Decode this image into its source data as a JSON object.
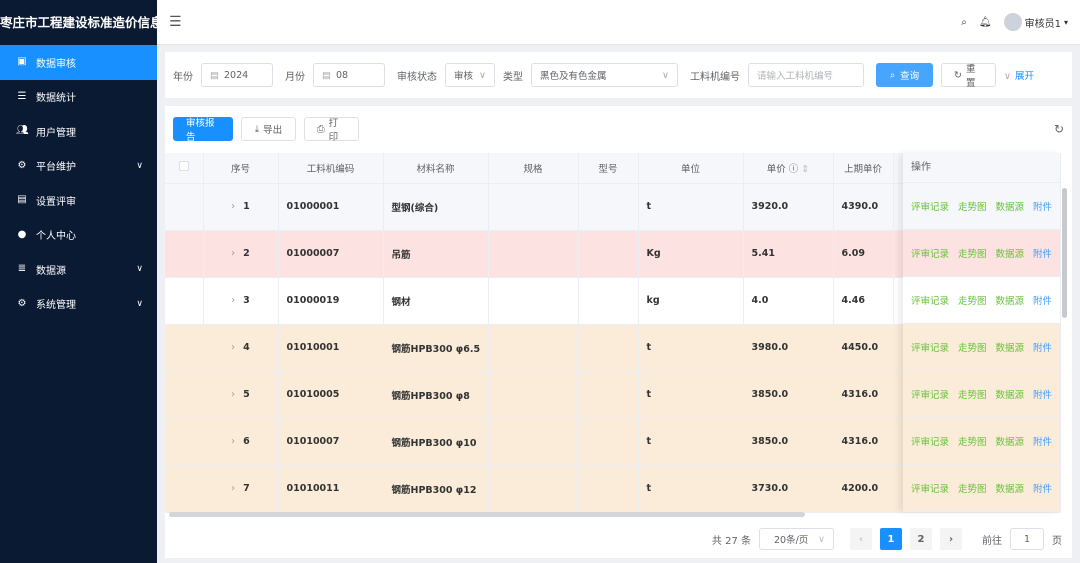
{
  "app": {
    "title": "枣庄市工程建设标准造价信息平台"
  },
  "sidebar": {
    "items": [
      {
        "label": "数据审核",
        "icon": "clipboard-icon",
        "active": true,
        "chevron": false
      },
      {
        "label": "数据统计",
        "icon": "list-icon",
        "chevron": false
      },
      {
        "label": "用户管理",
        "icon": "users-icon",
        "chevron": false
      },
      {
        "label": "平台维护",
        "icon": "gears-icon",
        "chevron": true
      },
      {
        "label": "设置评审",
        "icon": "review-icon",
        "chevron": false
      },
      {
        "label": "个人中心",
        "icon": "user-icon",
        "chevron": false
      },
      {
        "label": "数据源",
        "icon": "database-icon",
        "chevron": true
      },
      {
        "label": "系统管理",
        "icon": "gear-icon",
        "chevron": true
      }
    ]
  },
  "header": {
    "user": "审核员1"
  },
  "filters": {
    "year_label": "年份",
    "year": "2024",
    "month_label": "月份",
    "month": "08",
    "status_label": "审核状态",
    "status": "审核",
    "type_label": "类型",
    "type": "黑色及有色金属",
    "code_label": "工料机编号",
    "code_placeholder": "请输入工料机编号",
    "search": "查询",
    "reset": "重置",
    "expand": "展开"
  },
  "toolbar": {
    "report": "审核报告",
    "export": "导出",
    "print": "打印"
  },
  "table": {
    "columns": [
      "序号",
      "工料机编码",
      "材料名称",
      "规格",
      "型号",
      "单位",
      "单价",
      "上期单价",
      ""
    ],
    "op_header": "操作",
    "actions": [
      "评审记录",
      "走势图",
      "数据源",
      "附件"
    ],
    "rows": [
      {
        "no": "1",
        "code": "01000001",
        "name": "型钢(综合)",
        "spec": "",
        "model": "",
        "unit": "t",
        "price": "3920.0",
        "prev": "4390.0",
        "bg": "#f5f7fa"
      },
      {
        "no": "2",
        "code": "01000007",
        "name": "吊筋",
        "spec": "",
        "model": "",
        "unit": "Kg",
        "price": "5.41",
        "prev": "6.09",
        "bg": "#fde2e2"
      },
      {
        "no": "3",
        "code": "01000019",
        "name": "钢材",
        "spec": "",
        "model": "",
        "unit": "kg",
        "price": "4.0",
        "prev": "4.46",
        "bg": "#ffffff"
      },
      {
        "no": "4",
        "code": "01010001",
        "name": "钢筋HPB300 φ6.5",
        "spec": "",
        "model": "",
        "unit": "t",
        "price": "3980.0",
        "prev": "4450.0",
        "bg": "#faecd8"
      },
      {
        "no": "5",
        "code": "01010005",
        "name": "钢筋HPB300 φ8",
        "spec": "",
        "model": "",
        "unit": "t",
        "price": "3850.0",
        "prev": "4316.0",
        "bg": "#faecd8"
      },
      {
        "no": "6",
        "code": "01010007",
        "name": "钢筋HPB300 φ10",
        "spec": "",
        "model": "",
        "unit": "t",
        "price": "3850.0",
        "prev": "4316.0",
        "bg": "#faecd8"
      },
      {
        "no": "7",
        "code": "01010011",
        "name": "钢筋HPB300 φ12",
        "spec": "",
        "model": "",
        "unit": "t",
        "price": "3730.0",
        "prev": "4200.0",
        "bg": "#faecd8"
      }
    ]
  },
  "pagination": {
    "total": "共 27 条",
    "size": "20条/页",
    "pages": [
      "1",
      "2"
    ],
    "current": "1",
    "goto": "前往",
    "goto_value": "1",
    "page_suffix": "页"
  }
}
